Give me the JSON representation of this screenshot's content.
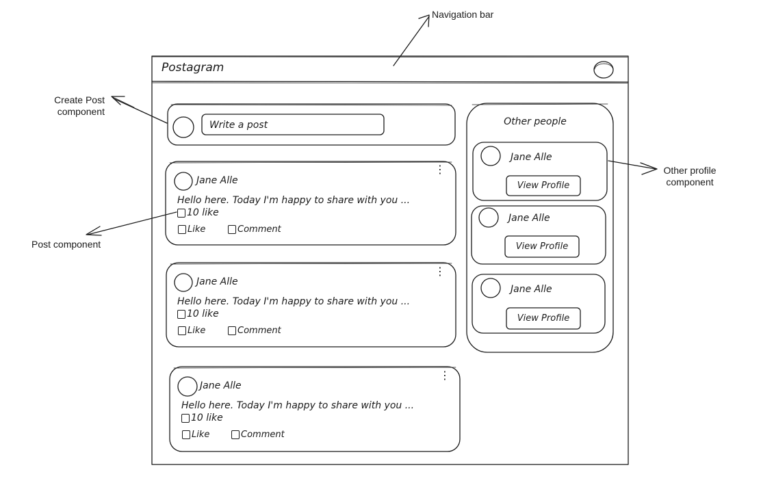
{
  "annotations": {
    "navigation_bar": "Navigation bar",
    "create_post_line1": "Create Post",
    "create_post_line2": "component",
    "other_profile_line1": "Other profile",
    "other_profile_line2": "component",
    "post_component": "Post component"
  },
  "nav": {
    "app_title": "Postagram",
    "avatar_icon": "avatar-icon"
  },
  "create_post": {
    "placeholder": "Write a post"
  },
  "sidebar": {
    "title": "Other people",
    "people": [
      {
        "name": "Jane Alle",
        "button": "View Profile"
      },
      {
        "name": "Jane Alle",
        "button": "View Profile"
      },
      {
        "name": "Jane Alle",
        "button": "View Profile"
      }
    ]
  },
  "posts": [
    {
      "author": "Jane Alle",
      "body": "Hello here. Today I'm happy to share with you ...",
      "likes": "10 like",
      "like_label": "Like",
      "comment_label": "Comment",
      "more_icon": "more-vertical-icon"
    },
    {
      "author": "Jane Alle",
      "body": "Hello here. Today I'm happy to share with you ...",
      "likes": "10 like",
      "like_label": "Like",
      "comment_label": "Comment",
      "more_icon": "more-vertical-icon"
    },
    {
      "author": "Jane Alle",
      "body": "Hello here. Today I'm happy to share with you ...",
      "likes": "10 like",
      "like_label": "Like",
      "comment_label": "Comment",
      "more_icon": "more-vertical-icon"
    }
  ],
  "colors": {
    "ink": "#1a1a1a",
    "background": "#ffffff"
  }
}
